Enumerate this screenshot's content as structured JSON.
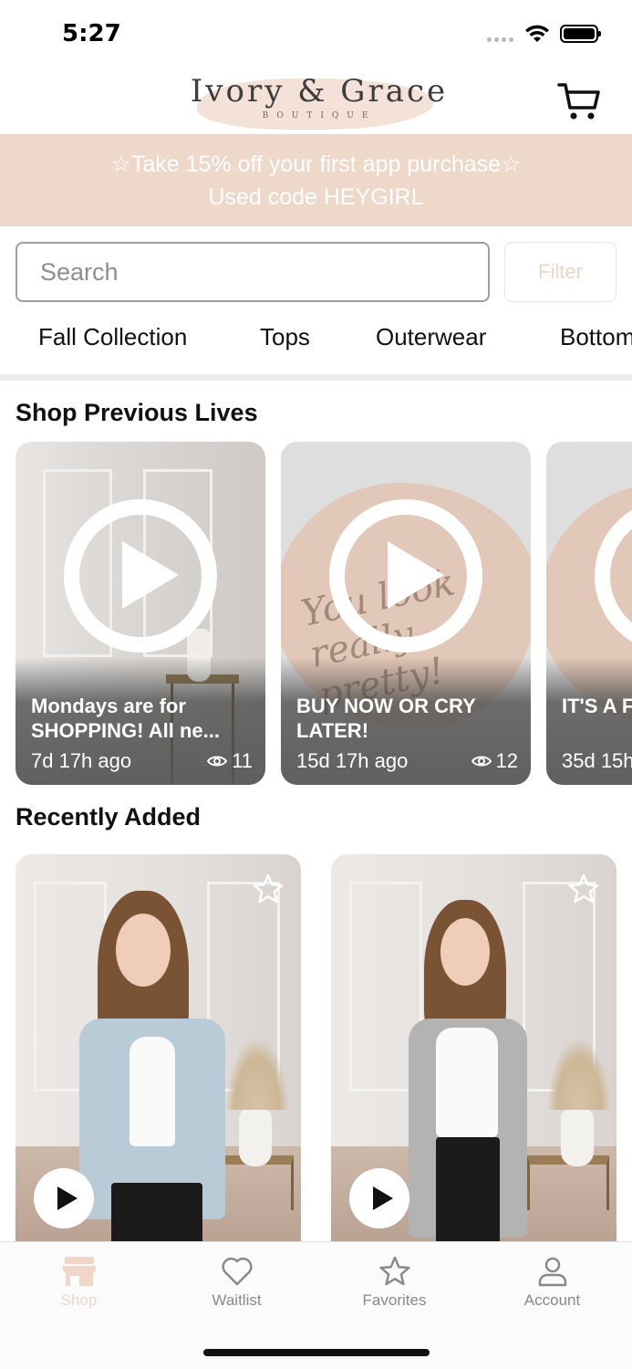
{
  "status_bar": {
    "time": "5:27"
  },
  "header": {
    "logo_name": "Ivory & Grace",
    "logo_sub": "BOUTIQUE",
    "cart_icon": "cart-icon"
  },
  "promo": {
    "line1": "☆Take 15% off your first app purchase☆",
    "line2": "Used code HEYGIRL"
  },
  "search": {
    "placeholder": "Search",
    "value": "",
    "filter_label": "Filter"
  },
  "categories": [
    "Fall Collection",
    "Tops",
    "Outerwear",
    "Bottoms"
  ],
  "lives": {
    "title": "Shop Previous Lives",
    "items": [
      {
        "title": "Mondays are for SHOPPING! All ne...",
        "time": "7d 17h ago",
        "views": "11"
      },
      {
        "title": "BUY NOW OR CRY LATER!",
        "time": "15d 17h ago",
        "views": "12"
      },
      {
        "title": "IT'S A F Sale wi",
        "time": "35d 15h",
        "views": ""
      }
    ],
    "script_text": "You look really pretty!"
  },
  "recent": {
    "title": "Recently Added"
  },
  "tabbar": {
    "items": [
      {
        "label": "Shop",
        "icon": "store-icon",
        "active": true
      },
      {
        "label": "Waitlist",
        "icon": "heart-icon",
        "active": false
      },
      {
        "label": "Favorites",
        "icon": "star-icon",
        "active": false
      },
      {
        "label": "Account",
        "icon": "person-icon",
        "active": false
      }
    ]
  },
  "colors": {
    "accent_blush": "#eed8ca",
    "active_tab": "#f0d6c6",
    "inactive_tab": "#8a8a8a"
  }
}
